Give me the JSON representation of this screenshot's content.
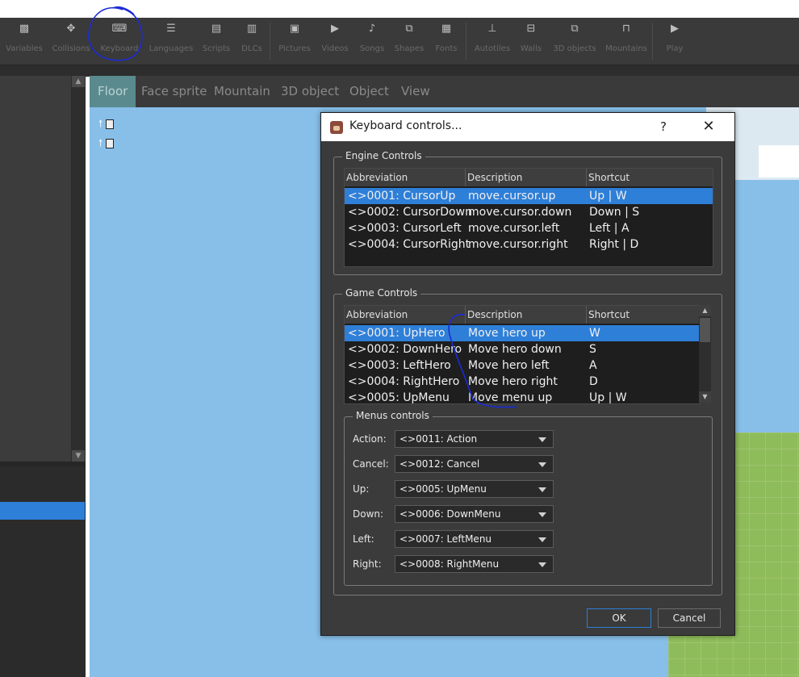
{
  "toolbar": {
    "items": [
      {
        "label": "Variables",
        "icon": "variables-icon",
        "glyph": "▩"
      },
      {
        "label": "Collisions",
        "icon": "move-icon",
        "glyph": "✥"
      },
      {
        "label": "Keyboard",
        "icon": "keyboard-icon",
        "glyph": "⌨"
      },
      {
        "label": "Languages",
        "icon": "languages-icon",
        "glyph": "☰"
      },
      {
        "label": "Scripts",
        "icon": "scripts-icon",
        "glyph": "▤"
      },
      {
        "label": "DLCs",
        "icon": "dlcs-icon",
        "glyph": "▥"
      },
      {
        "label": "Pictures",
        "icon": "pictures-icon",
        "glyph": "▣"
      },
      {
        "label": "Videos",
        "icon": "videos-icon",
        "glyph": "▶"
      },
      {
        "label": "Songs",
        "icon": "songs-icon",
        "glyph": "♪"
      },
      {
        "label": "Shapes",
        "icon": "shapes-icon",
        "glyph": "⧉"
      },
      {
        "label": "Fonts",
        "icon": "fonts-icon",
        "glyph": "▦"
      },
      {
        "label": "Autotiles",
        "icon": "autotiles-icon",
        "glyph": "⊥"
      },
      {
        "label": "Walls",
        "icon": "walls-icon",
        "glyph": "⊟"
      },
      {
        "label": "3D objects",
        "icon": "3d-objects-icon",
        "glyph": "⧉"
      },
      {
        "label": "Mountains",
        "icon": "mountains-icon",
        "glyph": "⊓"
      },
      {
        "label": "Play",
        "icon": "play-icon",
        "glyph": "▶"
      }
    ]
  },
  "tabs": [
    "Floor",
    "Face sprite",
    "Mountain",
    "3D object",
    "Object",
    "View"
  ],
  "dialog": {
    "title": "Keyboard controls...",
    "help": "?",
    "close": "✕",
    "engine": {
      "title": "Engine Controls",
      "headers": [
        "Abbreviation",
        "Description",
        "Shortcut"
      ],
      "rows": [
        [
          "<>0001: CursorUp",
          "move.cursor.up",
          "Up | W"
        ],
        [
          "<>0002: CursorDown",
          "move.cursor.down",
          "Down | S"
        ],
        [
          "<>0003: CursorLeft",
          "move.cursor.left",
          "Left | A"
        ],
        [
          "<>0004: CursorRight",
          "move.cursor.right",
          "Right | D"
        ]
      ]
    },
    "game": {
      "title": "Game Controls",
      "headers": [
        "Abbreviation",
        "Description",
        "Shortcut"
      ],
      "rows": [
        [
          "<>0001: UpHero",
          "Move hero up",
          "W"
        ],
        [
          "<>0002: DownHero",
          "Move hero down",
          "S"
        ],
        [
          "<>0003: LeftHero",
          "Move hero left",
          "A"
        ],
        [
          "<>0004: RightHero",
          "Move hero right",
          "D"
        ],
        [
          "<>0005: UpMenu",
          "Move menu up",
          "Up | W"
        ]
      ]
    },
    "menus": {
      "title": "Menus controls",
      "fields": [
        {
          "label": "Action:",
          "value": "<>0011: Action"
        },
        {
          "label": "Cancel:",
          "value": "<>0012: Cancel"
        },
        {
          "label": "Up:",
          "value": "<>0005: UpMenu"
        },
        {
          "label": "Down:",
          "value": "<>0006: DownMenu"
        },
        {
          "label": "Left:",
          "value": "<>0007: LeftMenu"
        },
        {
          "label": "Right:",
          "value": "<>0008: RightMenu"
        }
      ]
    },
    "ok": "OK",
    "cancel": "Cancel"
  },
  "colors": {
    "selection": "#2e7fd8",
    "map_sky": "#87bfe9",
    "grass": "#8fbc5a",
    "active_tab": "#5a8a8d",
    "annotation": "#1b2bd6"
  }
}
